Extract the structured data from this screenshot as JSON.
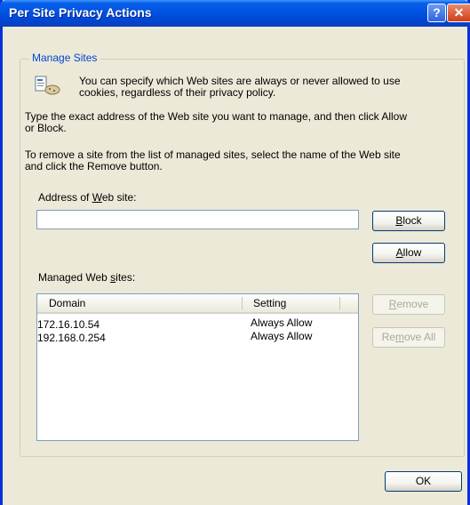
{
  "window": {
    "title": "Per Site Privacy Actions",
    "help_glyph": "?",
    "close_glyph": "✕"
  },
  "group": {
    "legend": "Manage Sites"
  },
  "intro": {
    "line1": "You can specify which Web sites are always or never allowed to use",
    "line2": "cookies, regardless of their privacy policy."
  },
  "instruction1": {
    "line1": "Type the exact address of the Web site you want to manage, and then click Allow",
    "line2": "or Block."
  },
  "instruction2": {
    "line1": "To remove a site from the list of managed sites, select the name of the Web site",
    "line2": "and click the Remove button."
  },
  "address": {
    "label_pre": "Address of ",
    "label_accel": "W",
    "label_post": "eb site:",
    "value": ""
  },
  "buttons": {
    "block": {
      "accel": "B",
      "rest": "lock"
    },
    "allow": {
      "accel": "A",
      "rest": "llow"
    },
    "remove": {
      "accel": "R",
      "rest": "emove"
    },
    "remove_all": {
      "pre": "Re",
      "accel": "m",
      "post": "ove All"
    },
    "ok": "OK"
  },
  "managed": {
    "label_pre": "Managed Web ",
    "label_accel": "s",
    "label_post": "ites:",
    "columns": [
      "Domain",
      "Setting"
    ],
    "rows": [
      {
        "domain": "172.16.10.54",
        "setting": "Always Allow"
      },
      {
        "domain": "192.168.0.254",
        "setting": "Always Allow"
      }
    ]
  },
  "colors": {
    "titlebar": "#0055e5",
    "dialog_bg": "#ece9d8",
    "legend": "#0046d5",
    "input_border": "#7f9db9"
  }
}
